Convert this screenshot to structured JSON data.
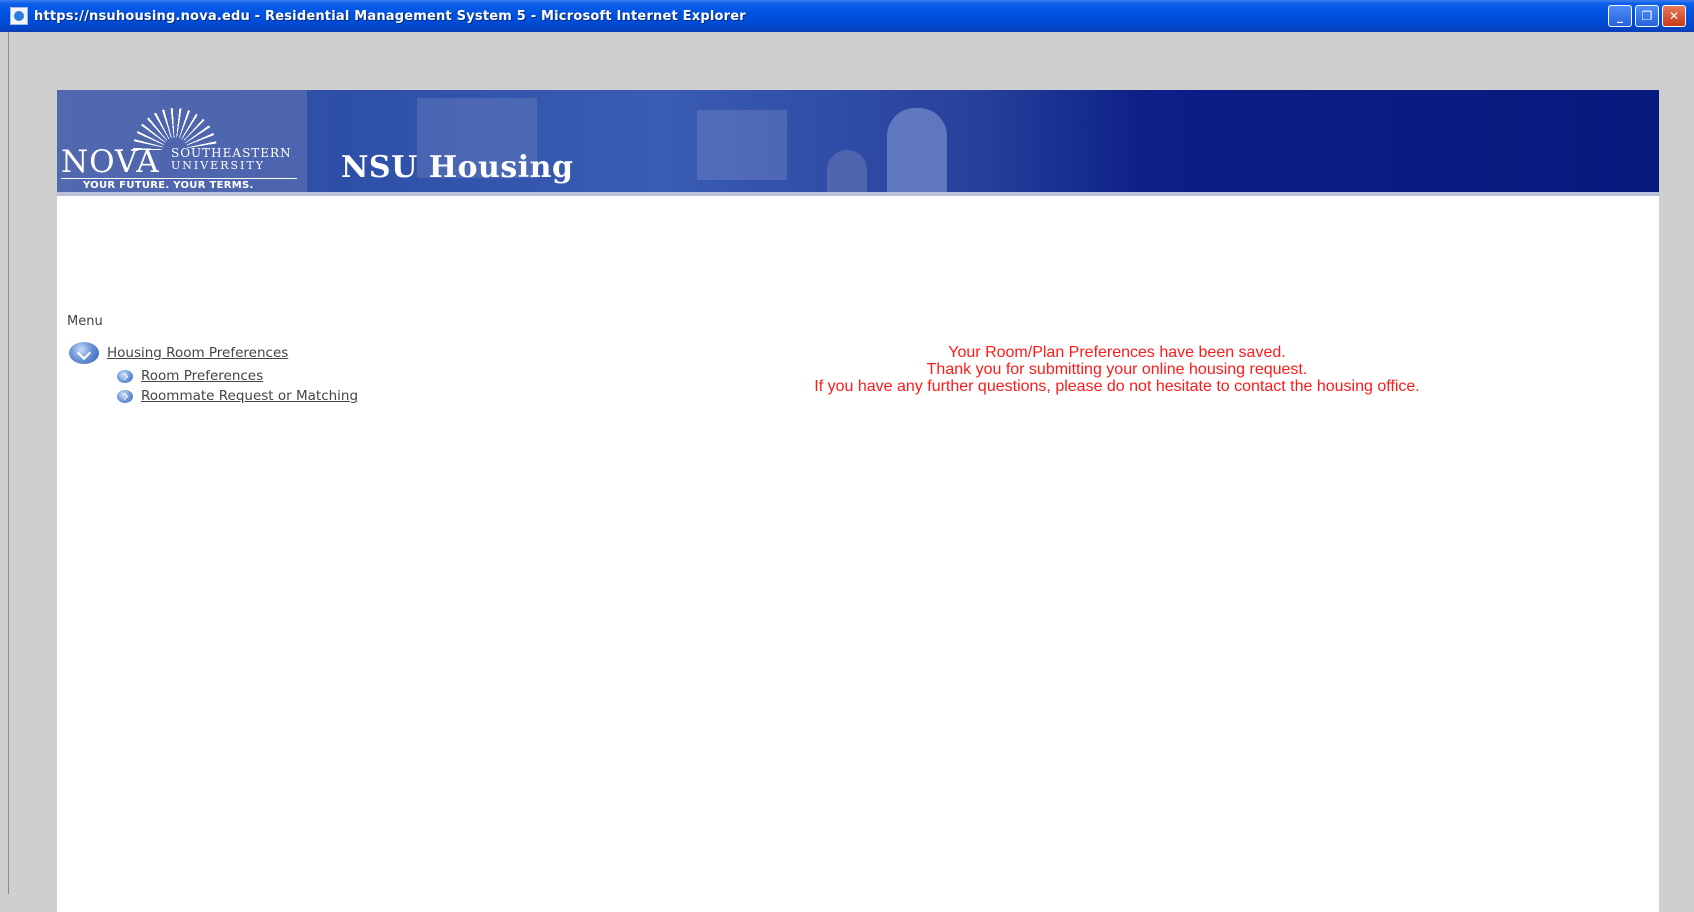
{
  "window": {
    "title": "https://nsuhousing.nova.edu - Residential Management System 5 - Microsoft Internet Explorer",
    "buttons": {
      "minimize": "_",
      "restore": "❐",
      "close": "✕"
    }
  },
  "banner": {
    "logo": {
      "wordmark": "NOVA",
      "line1": "SOUTHEASTERN",
      "line2": "UNIVERSITY",
      "tagline": "YOUR FUTURE. YOUR TERMS."
    },
    "site_title": "NSU Housing"
  },
  "menu": {
    "label": "Menu",
    "group": {
      "label": "Housing Room Preferences",
      "items": [
        {
          "label": "Room Preferences"
        },
        {
          "label": "Roommate Request or Matching"
        }
      ]
    }
  },
  "message": {
    "lines": [
      "Your Room/Plan Preferences have been saved.",
      "Thank you for submitting your online housing request.",
      "If you have any further questions, please do not hesitate to contact the housing office."
    ],
    "color": "#ff1a1a"
  }
}
